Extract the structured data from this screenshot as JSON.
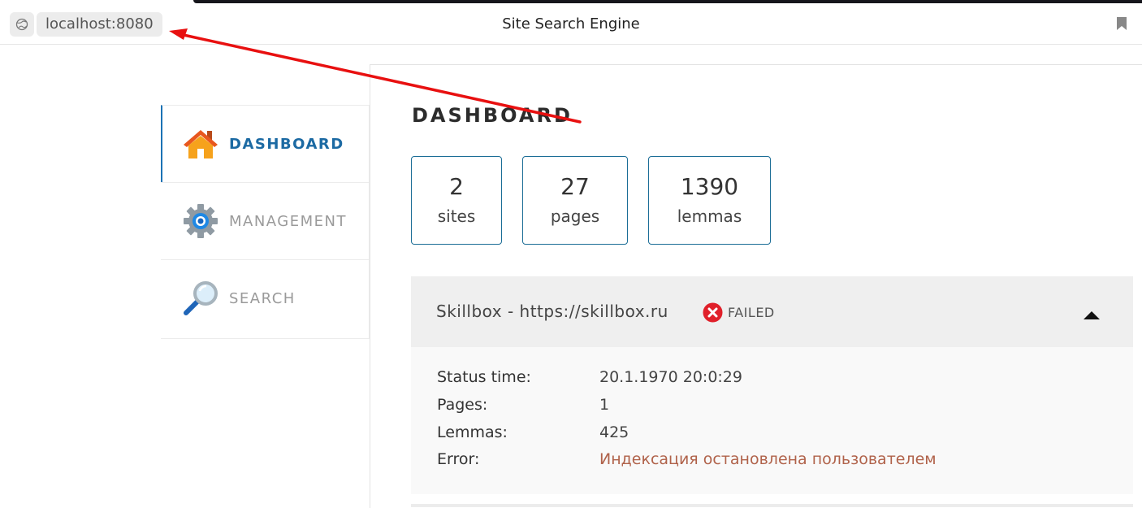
{
  "browser": {
    "url": "localhost:8080",
    "title": "Site Search Engine"
  },
  "sidebar": {
    "items": [
      {
        "label": "DASHBOARD",
        "icon": "home-icon",
        "active": true
      },
      {
        "label": "MANAGEMENT",
        "icon": "gear-icon",
        "active": false
      },
      {
        "label": "SEARCH",
        "icon": "magnifier-icon",
        "active": false
      }
    ]
  },
  "main": {
    "title": "DASHBOARD",
    "stats": [
      {
        "value": "2",
        "label": "sites"
      },
      {
        "value": "27",
        "label": "pages"
      },
      {
        "value": "1390",
        "label": "lemmas"
      }
    ],
    "site": {
      "name": "Skillbox - https://skillbox.ru",
      "status": "FAILED",
      "details": [
        {
          "key": "Status time:",
          "value": "20.1.1970 20:0:29"
        },
        {
          "key": "Pages:",
          "value": "1"
        },
        {
          "key": "Lemmas:",
          "value": "425"
        },
        {
          "key": "Error:",
          "value": "Индексация остановлена пользователем"
        }
      ]
    }
  },
  "colors": {
    "accent": "#1c6aa3",
    "stat_border": "#1b6d96",
    "error_text": "#b0624a",
    "failed_icon": "#e0202a",
    "annotation_arrow": "#e81010"
  }
}
